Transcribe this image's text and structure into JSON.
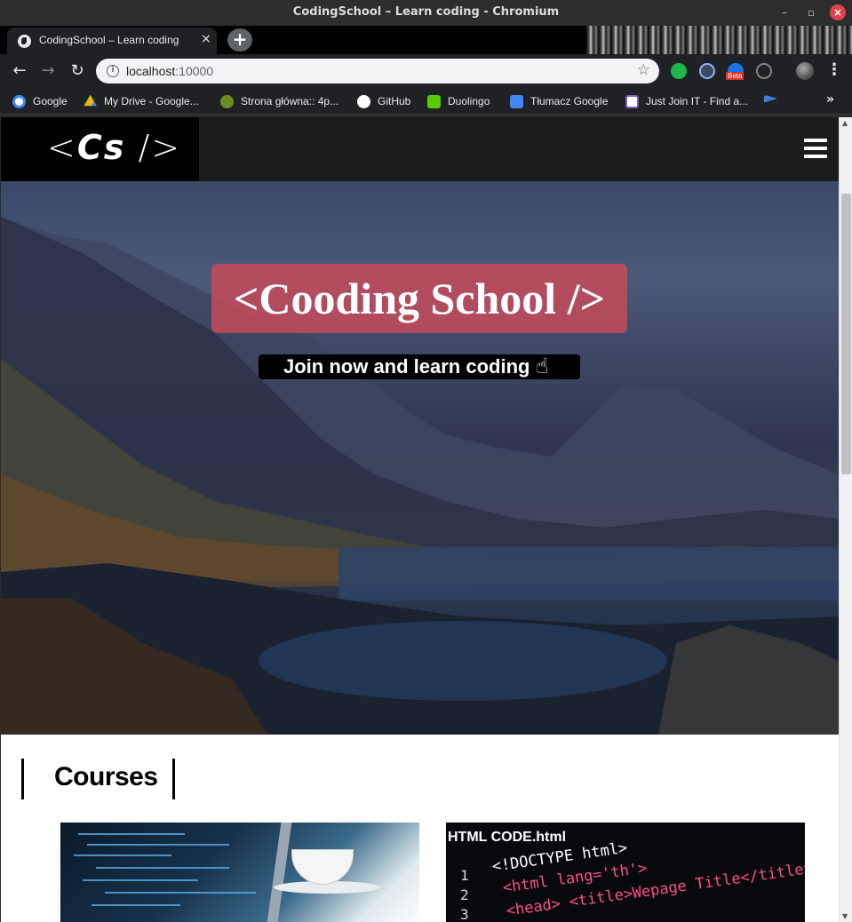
{
  "window": {
    "title": "CodingSchool – Learn coding - Chromium"
  },
  "tab": {
    "label": "CodingSchool – Learn coding",
    "close": "×",
    "new_tab": "+"
  },
  "toolbar": {
    "url_host": "localhost",
    "url_port": ":10000",
    "ext_beta": "Beta"
  },
  "bookmarks": [
    {
      "label": "Google",
      "color": "#ffffff"
    },
    {
      "label": "My Drive - Google...",
      "color": "#f4b400"
    },
    {
      "label": "Strona główna:: 4p...",
      "color": "#8bc34a"
    },
    {
      "label": "GitHub",
      "color": "#ffffff"
    },
    {
      "label": "Duolingo",
      "color": "#58cc02"
    },
    {
      "label": "Tłumacz Google",
      "color": "#4285f4"
    },
    {
      "label": "Just Join IT - Find a...",
      "color": "#7e57c2"
    }
  ],
  "site": {
    "logo_left": "<",
    "logo_mark": "Cs",
    "logo_right": " />",
    "hero_title": "<Cooding School />",
    "hero_cta": "Join now and learn coding",
    "courses_heading": "Courses",
    "course2_header": "HTML CODE.html",
    "course2_lines": [
      "1",
      "2",
      "3"
    ],
    "course2_code": [
      "<!DOCTYPE html>",
      "<html lang='th'>",
      "<head>   <title>Wepage Title</title>"
    ]
  },
  "colors": {
    "hero_title_bg": "#c44a5a",
    "nav_bg": "#1b1c1e"
  }
}
